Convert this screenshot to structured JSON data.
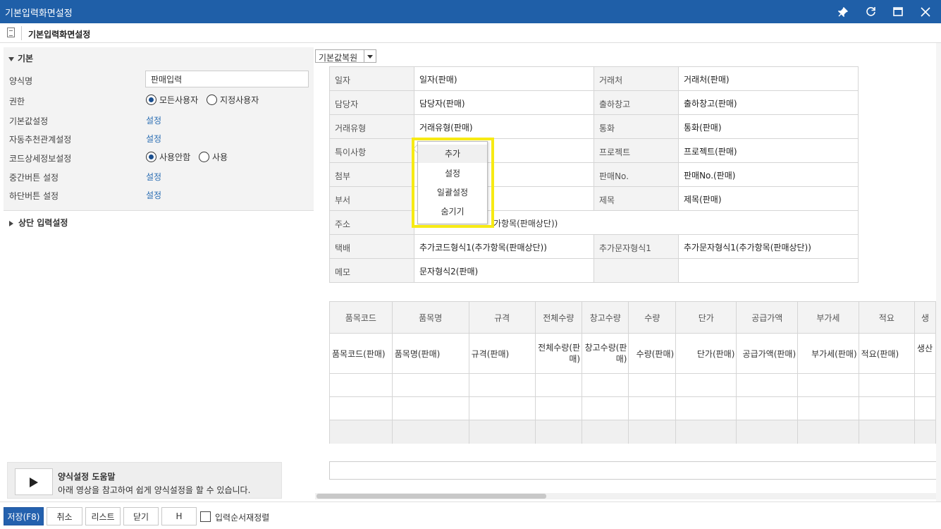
{
  "window": {
    "title": "기본입력화면설정",
    "controls": [
      "pin-icon",
      "refresh-icon",
      "maximize-icon",
      "close-icon"
    ]
  },
  "subheader": {
    "title": "기본입력화면설정"
  },
  "left": {
    "section_basic": "기본",
    "rows": {
      "form_name_label": "양식명",
      "form_name_value": "판매입력",
      "permission_label": "권한",
      "permission_opt1": "모든사용자",
      "permission_opt2": "지정사용자",
      "default_label": "기본값설정",
      "default_link": "설정",
      "auto_label": "자동추천관계설정",
      "auto_link": "설정",
      "code_label": "코드상세정보설정",
      "code_opt1": "사용안함",
      "code_opt2": "사용",
      "mid_label": "중간버튼 설정",
      "mid_link": "설정",
      "bottom_label": "하단버튼 설정",
      "bottom_link": "설정"
    },
    "section_top": "상단 입력설정",
    "help": {
      "title": "양식설정 도움말",
      "desc": "아래 영상을 참고하여 쉽게 양식설정을 할 수 있습니다."
    }
  },
  "toolbar": {
    "restore_default": "기본값복원"
  },
  "form_table": {
    "rows": [
      [
        "일자",
        "일자(판매)",
        "거래처",
        "거래처(판매)"
      ],
      [
        "담당자",
        "담당자(판매)",
        "출하창고",
        "출하창고(판매)"
      ],
      [
        "거래유형",
        "거래유형(판매)",
        "통화",
        "통화(판매)"
      ],
      [
        "특이사항",
        "",
        "프로젝트",
        "프로젝트(판매)"
      ],
      [
        "첨부",
        "",
        "판매No.",
        "판매No.(판매)"
      ],
      [
        "부서",
        "",
        "제목",
        "제목(판매)"
      ],
      [
        "주소",
        "추가항목(판매상단))",
        "",
        ""
      ],
      [
        "택배",
        "추가코드형식1(추가항목(판매상단))",
        "추가문자형식1",
        "추가문자형식1(추가항목(판매상단))"
      ],
      [
        "메모",
        "문자형식2(판매)",
        "",
        ""
      ]
    ],
    "address_value_visible": "가항목(판매상단))"
  },
  "context_menu": {
    "items": [
      "추가",
      "설정",
      "일괄설정",
      "숨기기"
    ]
  },
  "grid": {
    "headers": [
      "품목코드",
      "품목명",
      "규격",
      "전체수량",
      "창고수량",
      "수량",
      "단가",
      "공급가액",
      "부가세",
      "적요",
      "생"
    ],
    "values": [
      "품목코드(판매)",
      "품목명(판매)",
      "규격(판매)",
      "전체수량(판매)",
      "창고수량(판매)",
      "수량(판매)",
      "단가(판매)",
      "공급가액(판매)",
      "부가세(판매)",
      "적요(판매)",
      "생산"
    ]
  },
  "footer": {
    "save": "저장(F8)",
    "cancel": "취소",
    "list": "리스트",
    "close": "닫기",
    "h": "H",
    "reorder": "입력순서재정렬"
  },
  "colors": {
    "titlebar": "#1f5fa8",
    "primary_button": "#2461ae",
    "link": "#2a6db3",
    "highlight": "#f7ea14"
  }
}
